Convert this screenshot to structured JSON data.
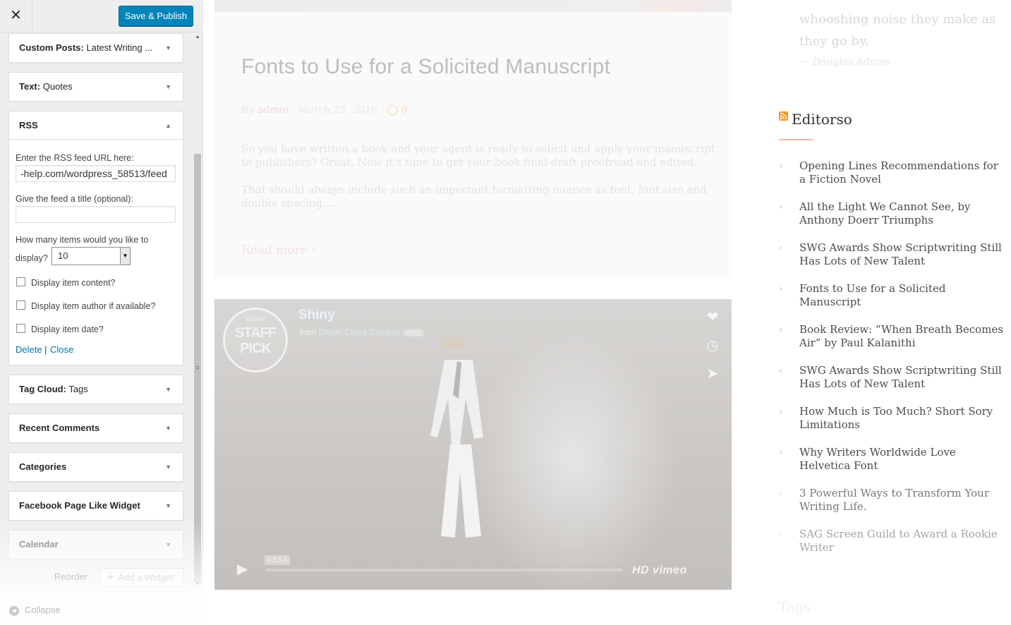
{
  "customizer": {
    "close_label": "✕",
    "save_label": "Save & Publish",
    "widgets_above": [
      {
        "type": "Custom Posts:",
        "title": "Latest Writing ..."
      },
      {
        "type": "Text:",
        "title": "Quotes"
      }
    ],
    "rss_widget": {
      "type": "RSS",
      "feed_url_label": "Enter the RSS feed URL here:",
      "feed_url_value": "-help.com/wordpress_58513/feed",
      "title_label": "Give the feed a title (optional):",
      "title_value": "",
      "items_label_1": "How many items would you like to",
      "items_label_2": "display?",
      "items_value": "10",
      "opt_content": "Display item content?",
      "opt_author": "Display item author if available?",
      "opt_date": "Display item date?",
      "delete_label": "Delete",
      "separator": "|",
      "close_label": "Close"
    },
    "widgets_below": [
      {
        "type": "Tag Cloud:",
        "title": "Tags"
      },
      {
        "type": "Recent Comments",
        "title": ""
      },
      {
        "type": "Categories",
        "title": ""
      },
      {
        "type": "Facebook Page Like Widget",
        "title": ""
      },
      {
        "type": "Calendar",
        "title": ""
      }
    ],
    "reorder_label": "Reorder",
    "add_widget_label": "Add a Widget",
    "collapse_label": "Collapse"
  },
  "preview": {
    "post": {
      "title": "Fonts to Use for a Solicited Manuscript",
      "by": "By",
      "author": "admin",
      "date": "March 25, 2016",
      "comments": "0",
      "excerpt_1": "So you have written a book and your agent is ready to solicit and apply your manuscript to publishers? Great. Now it's time to get your book final draft proofread and edited.",
      "excerpt_2": "That should always include such an important formatting nuance as font, font size and double spacing.…",
      "read_more": "Read more"
    },
    "video": {
      "badge_top": "vimeo",
      "badge_main": "STAFF PICK",
      "title": "Shiny",
      "from": "from",
      "author": "Daniel Cloud Campos",
      "pro": "PRO",
      "duration": "03:53",
      "logos": "HD vimeo"
    },
    "sidebar": {
      "quote": "whooshing noise they make as they go by.",
      "quote_author": "— Douglas Adams",
      "rss_title": "Editorso",
      "rss_items": [
        "Opening Lines Recommendations for a Fiction Novel",
        "All the Light We Cannot See, by Anthony Doerr Triumphs",
        "SWG Awards Show Scriptwriting Still Has Lots of New Talent",
        "Fonts to Use for a Solicited Manuscript",
        "Book Review: “When Breath Becomes Air” by Paul Kalanithi",
        "SWG Awards Show Scriptwriting Still Has Lots of New Talent",
        "How Much is Too Much? Short Sory Limitations",
        "Why Writers Worldwide Love Helvetica Font",
        "3 Powerful Ways to Transform Your Writing Life.",
        "SAG Screen Guild to Award a Rookie Writer"
      ],
      "tags_heading": "Tags"
    }
  }
}
